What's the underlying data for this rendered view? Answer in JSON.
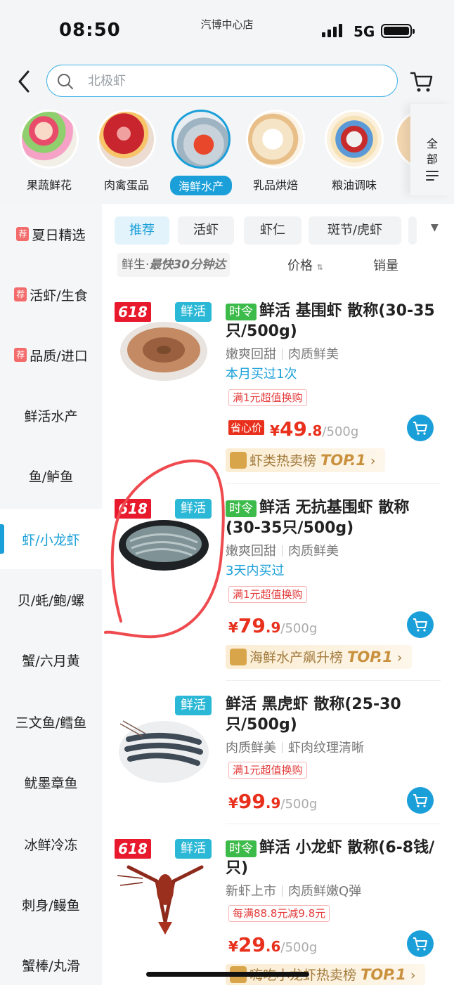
{
  "status_bar": {
    "time": "08:50",
    "store": "汽博中心店",
    "network": "5G"
  },
  "search": {
    "placeholder": "北极虾"
  },
  "categories": [
    {
      "label": "果蔬鲜花"
    },
    {
      "label": "肉禽蛋品"
    },
    {
      "label": "海鲜水产",
      "active": true
    },
    {
      "label": "乳品烘焙"
    },
    {
      "label": "粮油调味"
    }
  ],
  "all_categories": {
    "line1": "全",
    "line2": "部"
  },
  "sidebar": {
    "items": [
      {
        "label": "夏日精选",
        "tag": "荐"
      },
      {
        "label": "活虾/生食",
        "tag": "荐"
      },
      {
        "label": "品质/进口",
        "tag": "荐"
      },
      {
        "label": "鲜活水产"
      },
      {
        "label": "鱼/鲈鱼"
      },
      {
        "label": "虾/小龙虾",
        "active": true
      },
      {
        "label": "贝/蚝/鲍/螺"
      },
      {
        "label": "蟹/六月黄"
      },
      {
        "label": "三文鱼/鳕鱼"
      },
      {
        "label": "鱿墨章鱼"
      },
      {
        "label": "冰鲜冷冻"
      },
      {
        "label": "刺身/鳗鱼"
      },
      {
        "label": "蟹棒/丸滑"
      }
    ]
  },
  "subtabs": [
    "推荐",
    "活虾",
    "虾仁",
    "斑节/虎虾"
  ],
  "sortbar": {
    "fresh_prefix": "鲜生·",
    "fresh_text": "最快30分钟达",
    "price": "价格",
    "sales": "销量"
  },
  "products": [
    {
      "badge_618": "618",
      "badge_fresh": "鲜活",
      "season": "时令",
      "title": "鲜活 基围虾 散称(30-35只/500g)",
      "attr1": "嫩爽回甜",
      "attr2": "肉质鲜美",
      "bought": "本月买过1次",
      "promo": "满1元超值换购",
      "price_label": "省心价",
      "price_cur": "¥",
      "price_int": "49",
      "price_dec": ".8",
      "price_unit": "/500g",
      "rank_text": "虾类热卖榜",
      "rank_top": "TOP.1"
    },
    {
      "badge_618": "618",
      "badge_fresh": "鲜活",
      "season": "时令",
      "title": "鲜活 无抗基围虾 散称(30-35只/500g)",
      "attr1": "嫩爽回甜",
      "attr2": "肉质鲜美",
      "bought": "3天内买过",
      "promo": "满1元超值换购",
      "price_cur": "¥",
      "price_int": "79",
      "price_dec": ".9",
      "price_unit": "/500g",
      "rank_text": "海鲜水产飙升榜",
      "rank_top": "TOP.1"
    },
    {
      "badge_fresh": "鲜活",
      "title": "鲜活 黑虎虾 散称(25-30只/500g)",
      "attr1": "肉质鲜美",
      "attr2": "虾肉纹理清晰",
      "promo": "满1元超值换购",
      "price_cur": "¥",
      "price_int": "99",
      "price_dec": ".9",
      "price_unit": "/500g"
    },
    {
      "badge_618": "618",
      "badge_fresh": "鲜活",
      "season": "时令",
      "title": "鲜活 小龙虾 散称(6-8钱/只)",
      "attr1": "新虾上市",
      "attr2": "肉质鲜嫩Q弹",
      "promo": "每满88.8元减9.8元",
      "price_cur": "¥",
      "price_int": "29",
      "price_dec": ".6",
      "price_unit": "/500g",
      "rank_text": "嗨吃小龙虾热卖榜",
      "rank_top": "TOP.1"
    }
  ]
}
